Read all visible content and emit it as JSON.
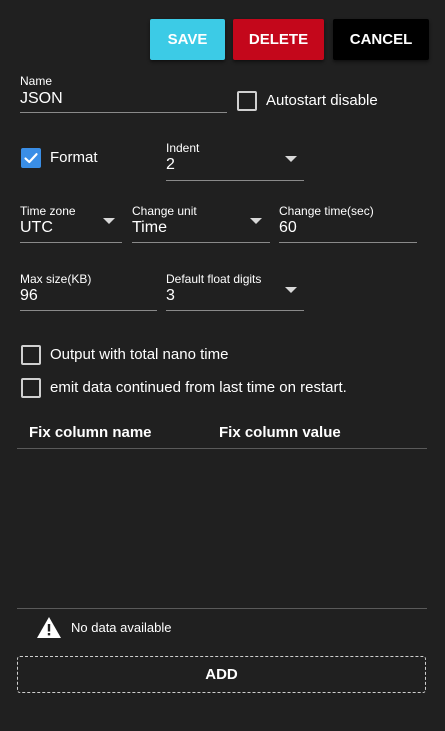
{
  "toolbar": {
    "save_label": "SAVE",
    "delete_label": "DELETE",
    "cancel_label": "CANCEL"
  },
  "form": {
    "name": {
      "label": "Name",
      "value": "JSON"
    },
    "autostart_disable": {
      "label": "Autostart disable",
      "checked": false
    },
    "format": {
      "label": "Format",
      "checked": true
    },
    "indent": {
      "label": "Indent",
      "value": "2"
    },
    "time_zone": {
      "label": "Time zone",
      "value": "UTC"
    },
    "change_unit": {
      "label": "Change unit",
      "value": "Time"
    },
    "change_time": {
      "label": "Change time(sec)",
      "value": "60"
    },
    "max_size": {
      "label": "Max size(KB)",
      "value": "96"
    },
    "default_float_digits": {
      "label": "Default float digits",
      "value": "3"
    },
    "output_total_nano": {
      "label": "Output with total nano time",
      "checked": false
    },
    "emit_continued": {
      "label": "emit data continued from last time on restart.",
      "checked": false
    }
  },
  "table": {
    "columns": [
      "Fix column name",
      "Fix column value"
    ],
    "empty_text": "No data available",
    "empty_icon": "warning-icon",
    "add_label": "ADD"
  },
  "colors": {
    "background": "#202020",
    "save": "#3ccbe6",
    "delete": "#c4071b",
    "cancel": "#000000",
    "checkbox_checked": "#3a8ee6"
  }
}
